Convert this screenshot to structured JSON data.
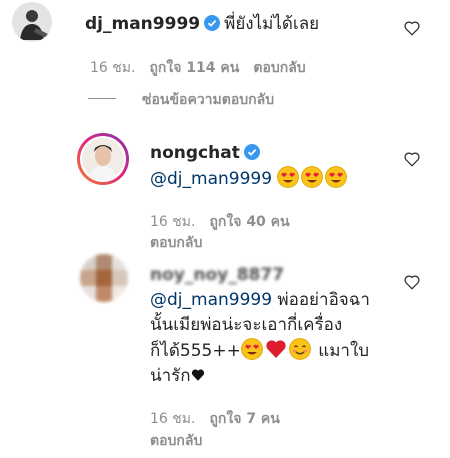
{
  "comments": [
    {
      "username": "dj_man9999",
      "verified": true,
      "text": "พี่ยังไม่ได้เลย",
      "time": "16 ชม.",
      "likes": "ถูกใจ 114 คน",
      "reply": "ตอบกลับ",
      "hide_replies": "ซ่อนข้อความตอบกลับ"
    }
  ],
  "replies": [
    {
      "username": "nongchat",
      "verified": true,
      "mention": "@dj_man9999",
      "time": "16 ชม.",
      "likes": "ถูกใจ 40 คน",
      "reply": "ตอบกลับ"
    },
    {
      "username": "noy_noy_8877",
      "mention": "@dj_man9999",
      "text_1": " พ่ออย่าอิจฉา",
      "text_2": "นั้นเมียพ่อน่ะจะเอากี่เครื่อง",
      "text_3": "ก็ได้555++",
      "text_4": " แมาใบ",
      "text_5": "น่ารัก",
      "time": "16 ชม.",
      "likes": "ถูกใจ 7 คน",
      "reply": "ตอบกลับ"
    }
  ],
  "icons": {
    "like": "heart-outline-icon",
    "verified": "verified-badge-icon",
    "emoji_love": "heart-eyes-emoji",
    "emoji_red_heart": "red-heart-emoji",
    "emoji_smile": "smiling-face-emoji",
    "emoji_black_heart": "black-heart-emoji"
  },
  "colors": {
    "verified": "#3897f0",
    "mention": "#00376b",
    "meta": "#8e8e8e",
    "story_ring_start": "#f58529",
    "story_ring_end": "#dd2a7b"
  }
}
